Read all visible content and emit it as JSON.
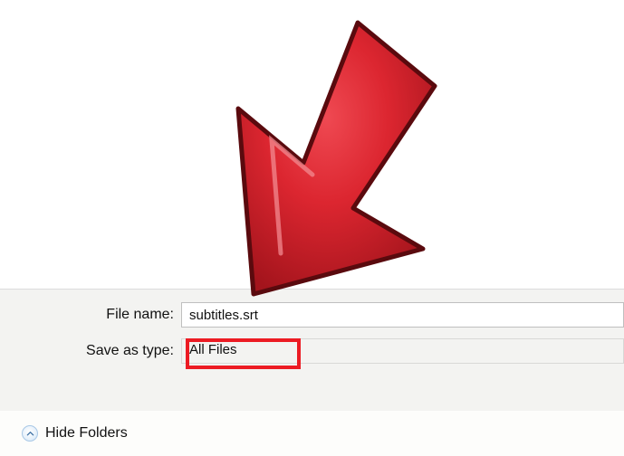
{
  "form": {
    "filename_label": "File name:",
    "filename_value": "subtitles.srt",
    "savetype_label": "Save as type:",
    "savetype_value": "All Files"
  },
  "footer": {
    "hide_folders_label": "Hide Folders"
  }
}
